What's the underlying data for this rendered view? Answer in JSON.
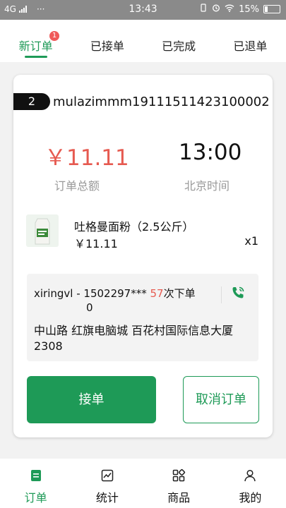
{
  "status_bar": {
    "network": "4G",
    "dots": "···",
    "time": "13:43",
    "battery": "15%"
  },
  "tabs": [
    {
      "label": "新订单",
      "badge": "1",
      "active": true
    },
    {
      "label": "已接单"
    },
    {
      "label": "已完成"
    },
    {
      "label": "已退单"
    }
  ],
  "order": {
    "number": "2",
    "id": "mulazimmm19111511423100002",
    "amount": "￥11.11",
    "amount_label": "订单总额",
    "time": "13:00",
    "time_label": "北京时间",
    "product": {
      "name": "吐格曼面粉（2.5公斤）",
      "price": "￥11.11",
      "qty": "x1"
    },
    "customer": {
      "name": "xiringvl",
      "separator": " - ",
      "phone": "1502297***",
      "phone_suffix": "0",
      "order_count": "57",
      "order_count_suffix": "次下单",
      "address": "中山路 红旗电脑城 百花村国际信息大厦2308"
    },
    "accept_label": "接单",
    "cancel_label": "取消订单"
  },
  "bottom_nav": [
    {
      "label": "订单",
      "icon": "order-icon",
      "active": true
    },
    {
      "label": "统计",
      "icon": "stats-icon"
    },
    {
      "label": "商品",
      "icon": "products-icon"
    },
    {
      "label": "我的",
      "icon": "profile-icon"
    }
  ],
  "colors": {
    "accent": "#1e9a57",
    "price": "#e65a50",
    "badge": "#f05a5a"
  }
}
